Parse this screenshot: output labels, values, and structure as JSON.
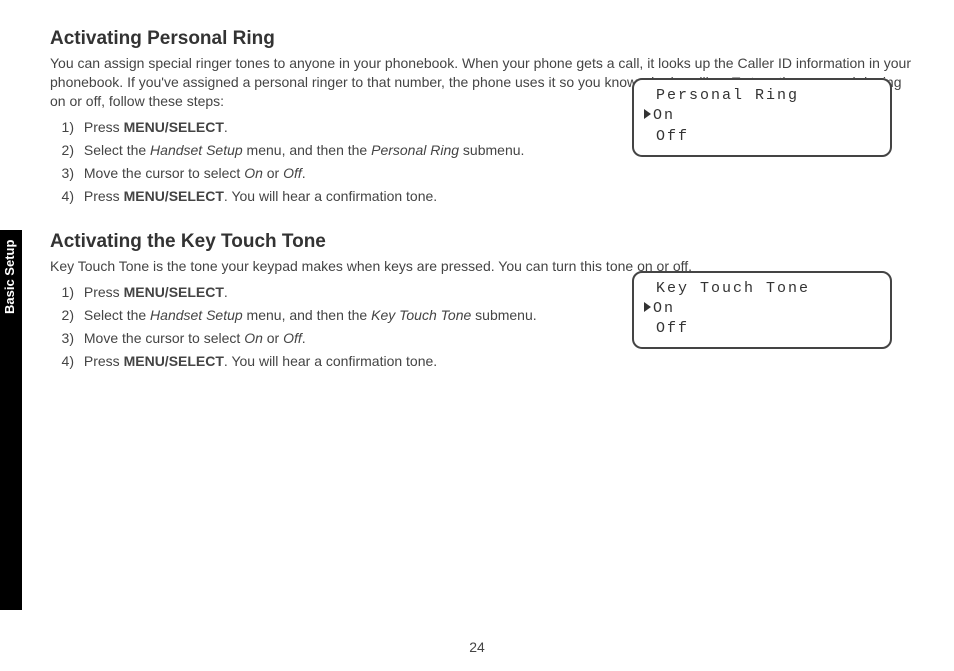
{
  "side_tab": "Basic Setup",
  "page_number": "24",
  "section1": {
    "heading": "Activating Personal Ring",
    "lead": "You can assign special ringer tones to anyone in your phonebook. When your phone gets a call, it looks up the Caller ID information in your phonebook. If you've assigned a personal ringer to that number, the phone uses it so you know who is calling. To turn the personal ringing on or off, follow these steps:",
    "steps": {
      "s1_pre": "Press ",
      "s1_bold": "MENU/SELECT",
      "s1_post": ".",
      "s2_pre": "Select the ",
      "s2_ital1": "Handset Setup",
      "s2_mid": " menu, and then the ",
      "s2_ital2": "Personal Ring",
      "s2_post": " submenu.",
      "s3_pre": "Move the cursor to select ",
      "s3_ital1": "On",
      "s3_mid": " or ",
      "s3_ital2": "Off",
      "s3_post": ".",
      "s4_pre": "Press ",
      "s4_bold": "MENU/SELECT",
      "s4_post": ". You will hear a confirmation tone."
    },
    "lcd": {
      "title": "Personal Ring",
      "opt1": "On",
      "opt2": "Off"
    }
  },
  "section2": {
    "heading": "Activating the Key Touch Tone",
    "lead": "Key Touch Tone is the tone your keypad makes when keys are pressed. You can turn this tone on or off.",
    "steps": {
      "s1_pre": "Press ",
      "s1_bold": "MENU/SELECT",
      "s1_post": ".",
      "s2_pre": "Select the ",
      "s2_ital1": "Handset Setup",
      "s2_mid": " menu, and then the ",
      "s2_ital2": "Key Touch Tone",
      "s2_post": " submenu.",
      "s3_pre": "Move the cursor to select ",
      "s3_ital1": "On",
      "s3_mid": " or ",
      "s3_ital2": "Off",
      "s3_post": ".",
      "s4_pre": "Press ",
      "s4_bold": "MENU/SELECT",
      "s4_post": ". You will hear a confirmation tone."
    },
    "lcd": {
      "title": "Key Touch Tone",
      "opt1": "On",
      "opt2": "Off"
    }
  }
}
